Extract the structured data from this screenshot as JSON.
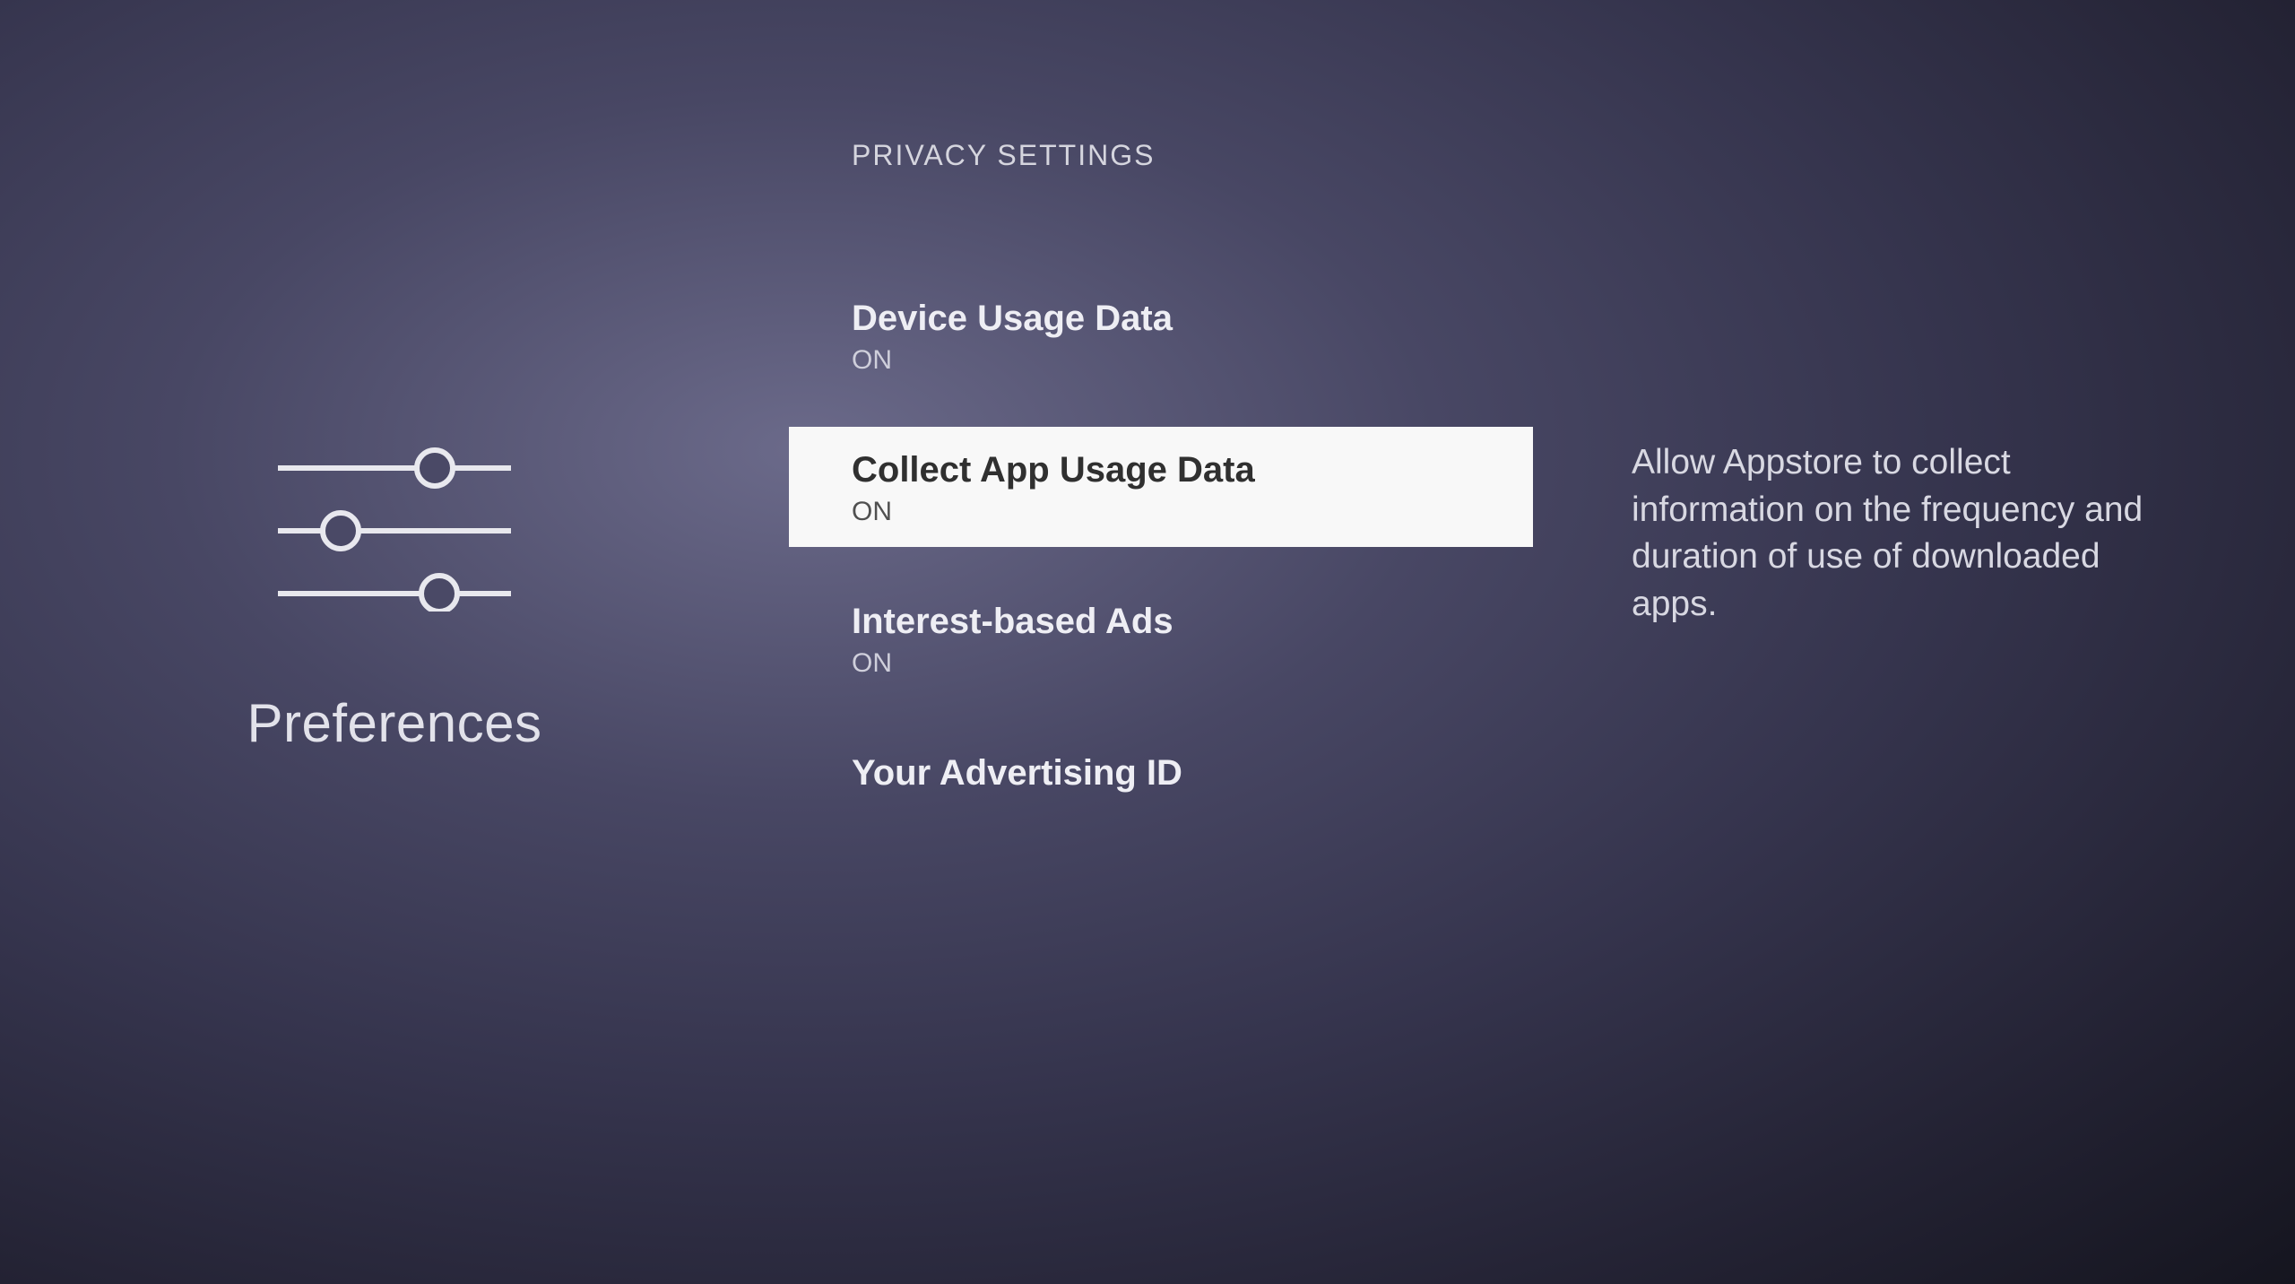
{
  "left": {
    "section_title": "Preferences"
  },
  "middle": {
    "header": "PRIVACY SETTINGS",
    "items": [
      {
        "title": "Device Usage Data",
        "status": "ON",
        "highlighted": false
      },
      {
        "title": "Collect App Usage Data",
        "status": "ON",
        "highlighted": true
      },
      {
        "title": "Interest-based Ads",
        "status": "ON",
        "highlighted": false
      },
      {
        "title": "Your Advertising ID",
        "status": null,
        "highlighted": false
      }
    ]
  },
  "right": {
    "description": "Allow Appstore to collect information on the frequency and duration of use of downloaded apps."
  }
}
